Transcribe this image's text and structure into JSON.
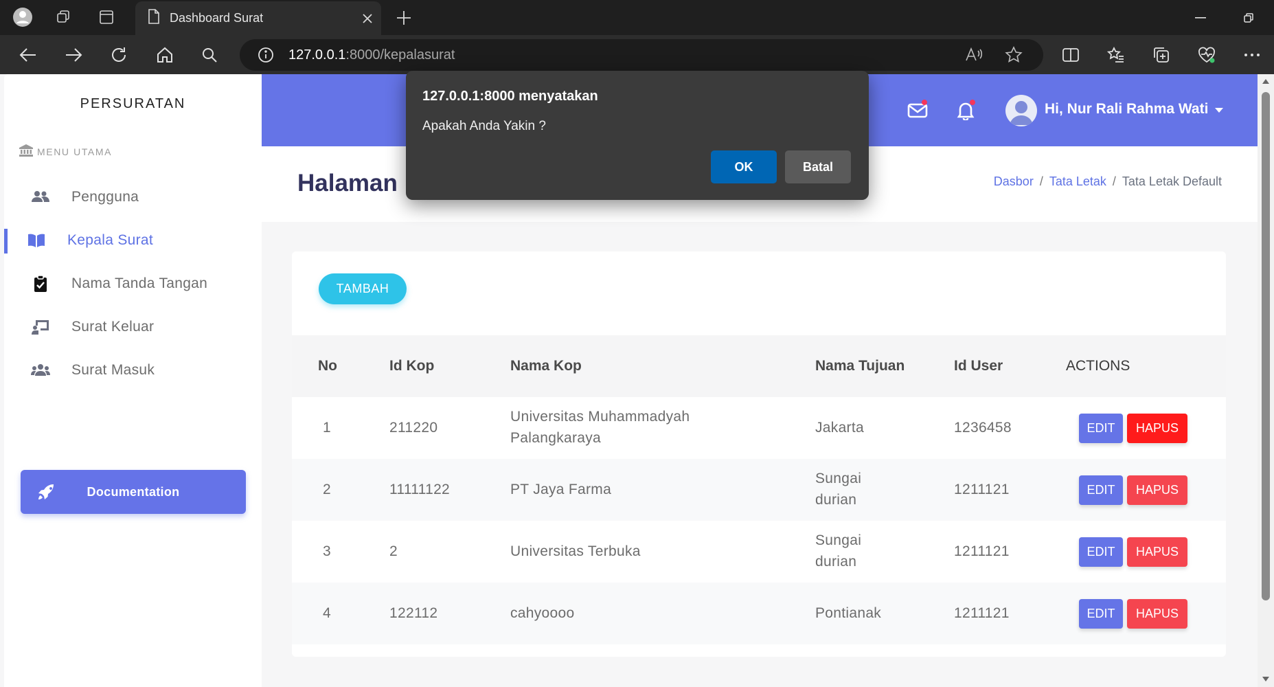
{
  "browser": {
    "tab_title": "Dashboard Surat",
    "url_host": "127.0.0.1",
    "url_rest": ":8000/kepalasurat"
  },
  "sidebar": {
    "brand": "PERSURATAN",
    "menu_heading": "MENU UTAMA",
    "items": [
      {
        "label": "Pengguna",
        "icon": "users-icon"
      },
      {
        "label": "Kepala Surat",
        "icon": "book-icon",
        "active": true
      },
      {
        "label": "Nama Tanda Tangan",
        "icon": "clipboard-check-icon"
      },
      {
        "label": "Surat Keluar",
        "icon": "chalkboard-user-icon"
      },
      {
        "label": "Surat Masuk",
        "icon": "user-group-icon"
      }
    ],
    "doc_button": "Documentation"
  },
  "topnav": {
    "greeting": "Hi, Nur Rali Rahma Wati"
  },
  "header": {
    "title": "Halaman",
    "breadcrumbs": [
      "Dasbor",
      "Tata Letak",
      "Tata Letak Default"
    ]
  },
  "main": {
    "add_button": "TAMBAH",
    "columns": [
      "No",
      "Id Kop",
      "Nama Kop",
      "Nama Tujuan",
      "Id User",
      "ACTIONS"
    ],
    "rows": [
      {
        "no": "1",
        "id_kop": "211220",
        "nama_kop": [
          "Universitas Muhammadyah",
          "Palangkaraya"
        ],
        "nama_tujuan": [
          "Jakarta"
        ],
        "id_user": "1236458"
      },
      {
        "no": "2",
        "id_kop": "11111122",
        "nama_kop": [
          "PT Jaya Farma"
        ],
        "nama_tujuan": [
          "Sungai",
          "durian"
        ],
        "id_user": "1211121"
      },
      {
        "no": "3",
        "id_kop": "2",
        "nama_kop": [
          "Universitas Terbuka"
        ],
        "nama_tujuan": [
          "Sungai",
          "durian"
        ],
        "id_user": "1211121"
      },
      {
        "no": "4",
        "id_kop": "122112",
        "nama_kop": [
          "cahyoooo"
        ],
        "nama_tujuan": [
          "Pontianak"
        ],
        "id_user": "1211121"
      }
    ],
    "edit_label": "EDIT",
    "delete_label": "HAPUS"
  },
  "dialog": {
    "title": "127.0.0.1:8000 menyatakan",
    "message": "Apakah Anda Yakin ?",
    "ok": "OK",
    "cancel": "Batal"
  },
  "colors": {
    "accent": "#5e72e4",
    "topnav": "#6574e7",
    "info": "#2ec3e8",
    "danger": "#f5454f"
  }
}
